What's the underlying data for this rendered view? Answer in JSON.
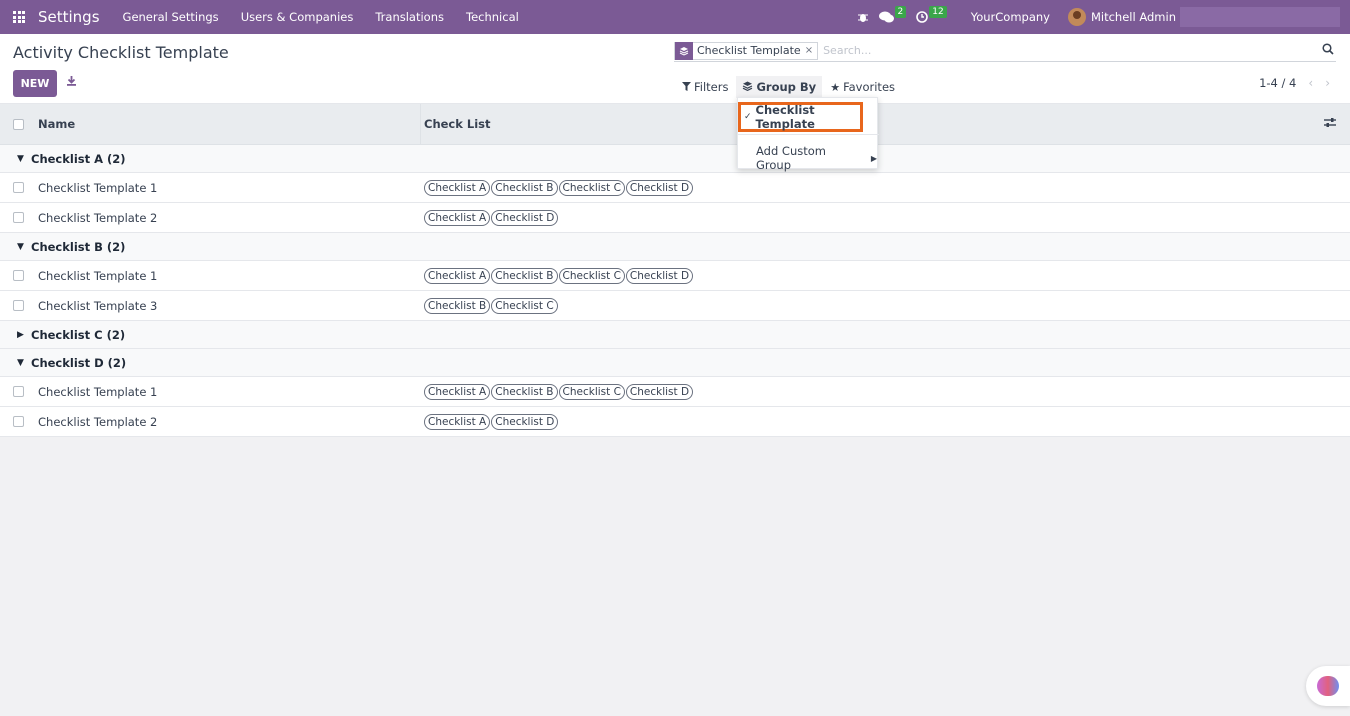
{
  "navbar": {
    "brand": "Settings",
    "links": [
      "General Settings",
      "Users & Companies",
      "Translations",
      "Technical"
    ],
    "messages_count": "2",
    "activities_count": "12",
    "company": "YourCompany",
    "user": "Mitchell Admin"
  },
  "control": {
    "title": "Activity Checklist Template",
    "new_label": "NEW",
    "facet_label": "Checklist Template",
    "facet_close": "×",
    "search_placeholder": "Search...",
    "filters_label": "Filters",
    "groupby_label": "Group By",
    "favorites_label": "Favorites",
    "pager": "1-4 / 4"
  },
  "list": {
    "headers": {
      "name": "Name",
      "checklist": "Check List"
    },
    "groups": [
      {
        "label": "Checklist A (2)",
        "expanded": true,
        "rows": [
          {
            "name": "Checklist Template 1",
            "tags": [
              "Checklist A",
              "Checklist B",
              "Checklist C",
              "Checklist D"
            ]
          },
          {
            "name": "Checklist Template 2",
            "tags": [
              "Checklist A",
              "Checklist D"
            ]
          }
        ]
      },
      {
        "label": "Checklist B (2)",
        "expanded": true,
        "rows": [
          {
            "name": "Checklist Template 1",
            "tags": [
              "Checklist A",
              "Checklist B",
              "Checklist C",
              "Checklist D"
            ]
          },
          {
            "name": "Checklist Template 3",
            "tags": [
              "Checklist B",
              "Checklist C"
            ]
          }
        ]
      },
      {
        "label": "Checklist C (2)",
        "expanded": false,
        "rows": []
      },
      {
        "label": "Checklist D (2)",
        "expanded": true,
        "rows": [
          {
            "name": "Checklist Template 1",
            "tags": [
              "Checklist A",
              "Checklist B",
              "Checklist C",
              "Checklist D"
            ]
          },
          {
            "name": "Checklist Template 2",
            "tags": [
              "Checklist A",
              "Checklist D"
            ]
          }
        ]
      }
    ]
  },
  "dropdown": {
    "item_checked": "Checklist Template",
    "item_custom": "Add Custom Group"
  },
  "colors": {
    "brand": "#7b5a95",
    "highlight": "#e8661c",
    "badge": "#3aa64a"
  },
  "icons": [
    "apps-grid-icon",
    "bug-icon",
    "chat-icon",
    "clock-icon",
    "download-icon",
    "layers-icon",
    "filter-icon",
    "star-icon",
    "search-icon",
    "settings-sliders-icon",
    "ai-brain-icon"
  ]
}
